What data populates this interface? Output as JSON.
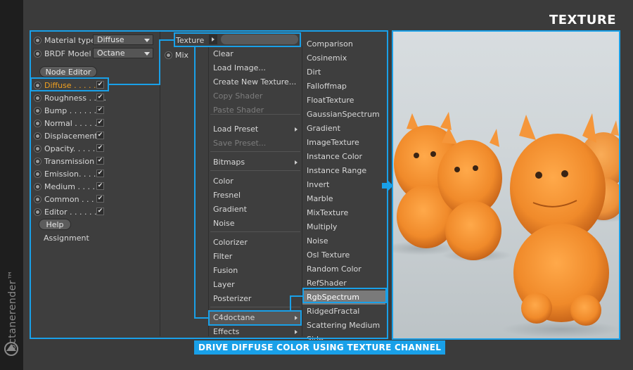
{
  "brand": {
    "name": "octanerender™"
  },
  "header": {
    "title": "TEXTURE"
  },
  "material": {
    "type_label": "Material type",
    "type_value": "Diffuse",
    "brdf_label": "BRDF Model",
    "brdf_value": "Octane",
    "node_editor": "Node Editor",
    "channels": [
      {
        "label": "Diffuse . . . . .",
        "checked": true
      },
      {
        "label": "Roughness . . . .",
        "checked": true
      },
      {
        "label": "Bump . . . . . .",
        "checked": true
      },
      {
        "label": "Normal . . . . .",
        "checked": true
      },
      {
        "label": "Displacement",
        "checked": true
      },
      {
        "label": "Opacity. . . . .",
        "checked": true
      },
      {
        "label": "Transmission",
        "checked": true
      },
      {
        "label": "Emission. . . .",
        "checked": true
      },
      {
        "label": "Medium . . . .",
        "checked": true
      },
      {
        "label": "Common . . . .",
        "checked": true
      },
      {
        "label": "Editor . . . . . .",
        "checked": true
      }
    ],
    "help": "Help",
    "assignment": "Assignment"
  },
  "texture_field": {
    "label": "Texture",
    "mix_label": "Mix"
  },
  "context_menu": {
    "items": [
      "Clear",
      "Load Image...",
      "Create New Texture...",
      "Copy Shader",
      "Paste Shader",
      "Load Preset",
      "Save Preset...",
      "Bitmaps",
      "Color",
      "Fresnel",
      "Gradient",
      "Noise",
      "Colorizer",
      "Filter",
      "Fusion",
      "Layer",
      "Posterizer",
      "C4doctane",
      "Effects"
    ]
  },
  "submenu": {
    "items": [
      "Comparison",
      "Cosinemix",
      "Dirt",
      "Falloffmap",
      "FloatTexture",
      "GaussianSpectrum",
      "Gradient",
      "ImageTexture",
      "Instance Color",
      "Instance Range",
      "Invert",
      "Marble",
      "MixTexture",
      "Multiply",
      "Noise",
      "Osl Texture",
      "Random Color",
      "RefShader",
      "RgbSpectrum",
      "RidgedFractal",
      "Scattering Medium",
      "Side"
    ]
  },
  "caption": "DRIVE DIFFUSE COLOR USING TEXTURE CHANNEL",
  "colors": {
    "accent": "#19a0e8",
    "diffuse_label": "#f0a020",
    "figure": "#f08a2a"
  }
}
